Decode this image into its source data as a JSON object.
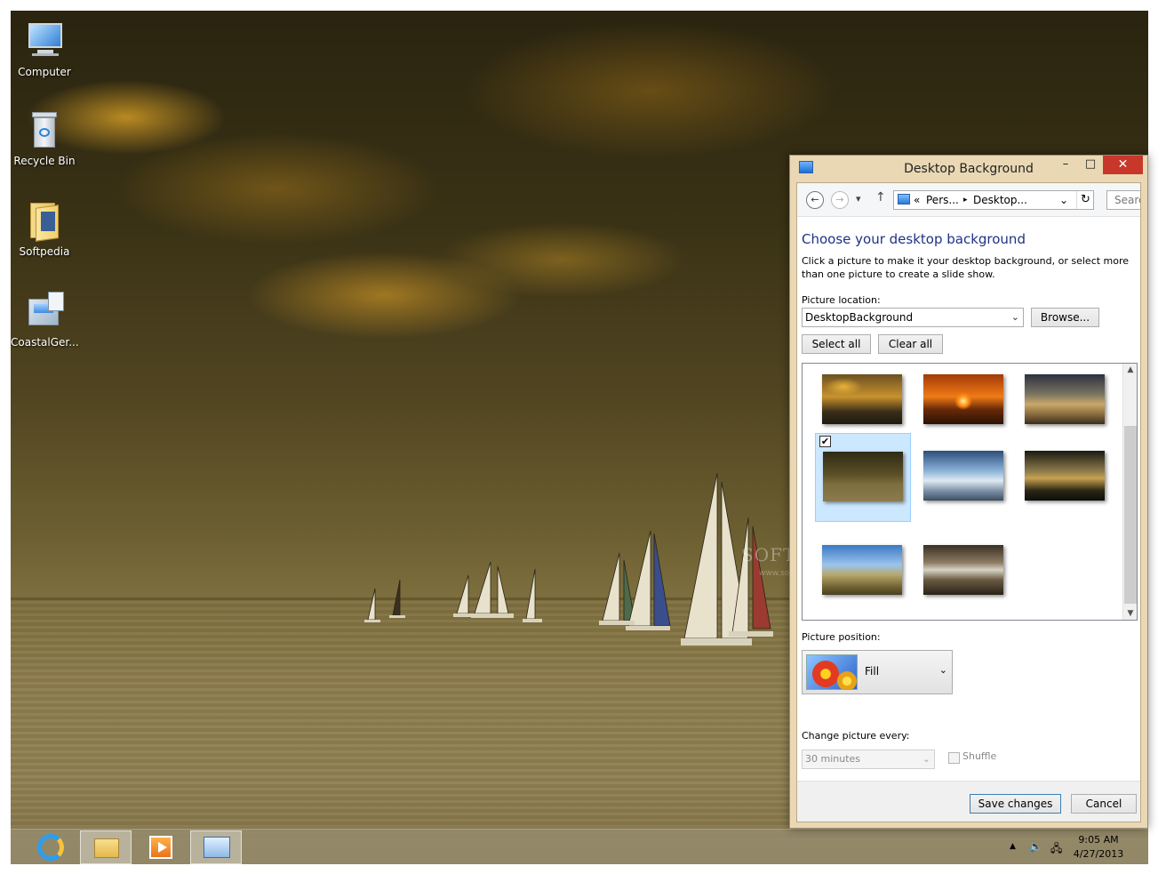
{
  "desktop": {
    "icons": [
      {
        "label": "Computer"
      },
      {
        "label": "Recycle Bin"
      },
      {
        "label": "Softpedia"
      },
      {
        "label": "CoastalGer..."
      }
    ],
    "watermark": "SOFTPEDIA",
    "watermark_sub": "www.softpedia.com"
  },
  "taskbar": {
    "time": "9:05 AM",
    "date": "4/27/2013",
    "apps": [
      "internet-explorer",
      "file-explorer",
      "media-player",
      "control-panel"
    ]
  },
  "window": {
    "title": "Desktop Background",
    "minimize": "–",
    "maximize": "□",
    "close": "✕",
    "nav": {
      "back": "←",
      "forward": "→",
      "recent": "▾",
      "up": "↑",
      "chevrons": "«",
      "crumb1": "Pers...",
      "sep": "▸",
      "crumb2": "Desktop...",
      "dropdown": "⌄",
      "refresh": "↻",
      "search_placeholder": "Search"
    },
    "heading": "Choose your desktop background",
    "description": "Click a picture to make it your desktop background, or select more than one picture to create a slide show.",
    "picture_location_label": "Picture location:",
    "picture_location_value": "DesktopBackground",
    "browse_label": "Browse...",
    "select_all_label": "Select all",
    "clear_all_label": "Clear all",
    "thumbnails": [
      {
        "name": "sailboats-dusk",
        "selected": false
      },
      {
        "name": "orange-sunset",
        "selected": false
      },
      {
        "name": "sandy-shore",
        "selected": false
      },
      {
        "name": "sailboats-sea",
        "selected": true
      },
      {
        "name": "frozen-coast",
        "selected": false
      },
      {
        "name": "lake-reflection",
        "selected": false
      },
      {
        "name": "lighthouse-field",
        "selected": false
      },
      {
        "name": "river-reflection",
        "selected": false
      }
    ],
    "checkmark": "✔",
    "picture_position_label": "Picture position:",
    "picture_position_value": "Fill",
    "change_every_label": "Change picture every:",
    "change_every_value": "30 minutes",
    "shuffle_label": "Shuffle",
    "save_label": "Save changes",
    "cancel_label": "Cancel"
  },
  "colors": {
    "heading": "#1e3287",
    "close": "#c7382b",
    "selection": "#cce8ff"
  }
}
